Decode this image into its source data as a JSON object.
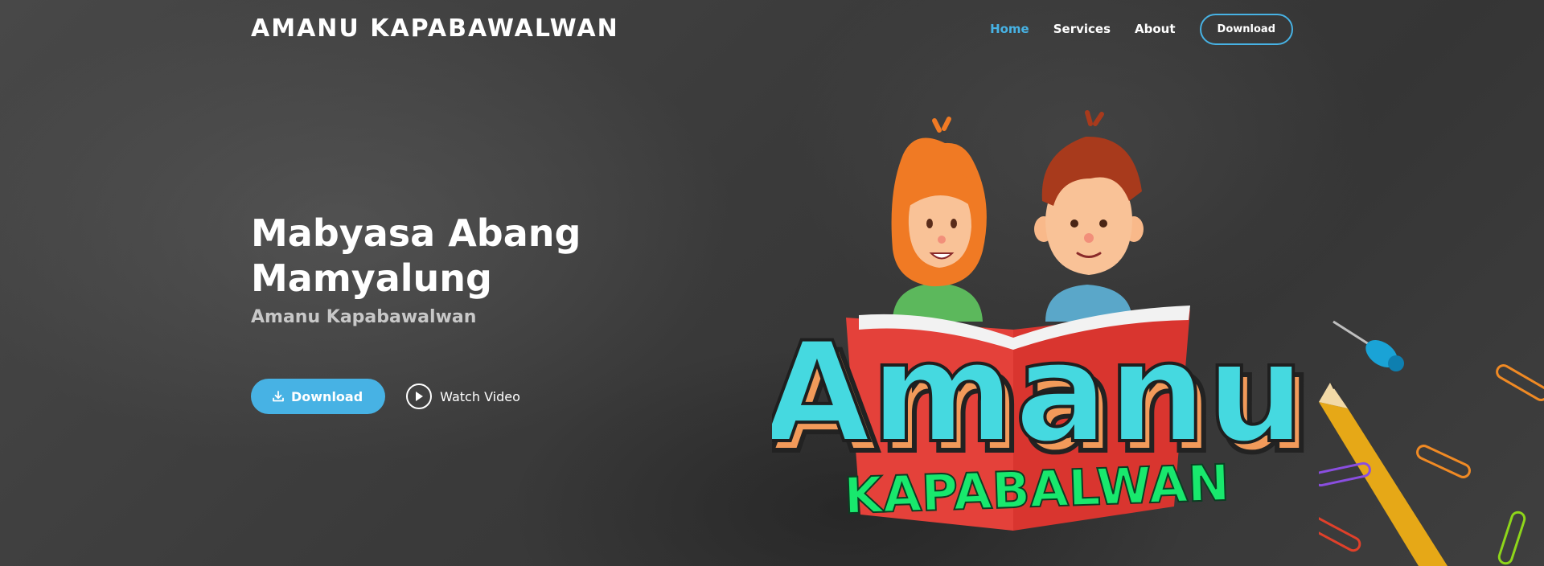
{
  "header": {
    "logo_text": "AMANU KAPABAWALWAN",
    "nav": [
      {
        "label": "Home",
        "active": true
      },
      {
        "label": "Services"
      },
      {
        "label": "About"
      }
    ],
    "download_label": "Download"
  },
  "hero": {
    "title_line1": "Mabyasa Abang",
    "title_line2": "Mamyalung",
    "subtitle": "Amanu Kapabawalwan",
    "download_button": "Download",
    "watch_video": "Watch Video"
  },
  "artwork": {
    "logo_word": "Amanu",
    "logo_subword": "KAPABALWAN"
  },
  "colors": {
    "accent": "#47b2e4",
    "background": "#3b3b3b",
    "logo_cyan": "#45d9e0",
    "logo_green": "#18e86d",
    "book_red": "#e4413a"
  },
  "icons": {
    "download": "download-icon",
    "play": "play-icon"
  }
}
